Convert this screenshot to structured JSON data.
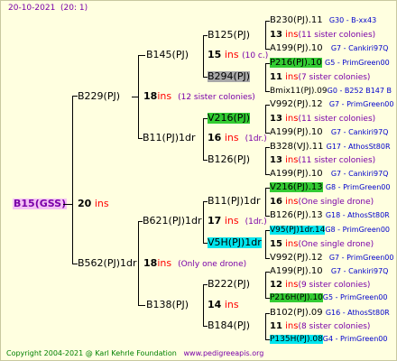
{
  "header": {
    "date": "20-10-2021",
    "time": "(20:  1)"
  },
  "footer": {
    "copyright": "Copyright 2004-2021 @ Karl Kehrle Foundation",
    "site": "www.pedigreeapis.org"
  },
  "root": {
    "name": "B15(GSS)",
    "ins_num": "20",
    "ins": "ins"
  },
  "gen1": {
    "top": {
      "name": "B229(PJ)",
      "ins_num": "18",
      "ins": "ins",
      "sisters": "(12 sister colonies)"
    },
    "bottom": {
      "name": "B562(PJ)1dr",
      "ins_num": "18",
      "ins": "ins",
      "note": "(Only one drone)"
    }
  },
  "gen2": {
    "b145": {
      "name": "B145(PJ)",
      "ins_num": "15",
      "ins": "ins",
      "note": "(10 c.)"
    },
    "b11": {
      "name": "B11(PJ)1dr",
      "ins_num": "16",
      "ins": "ins",
      "note": "(1dr.)"
    },
    "b621": {
      "name": "B621(PJ)1dr",
      "ins_num": "17",
      "ins": "ins",
      "note": "(1dr.)"
    },
    "b138": {
      "name": "B138(PJ)",
      "ins_num": "14",
      "ins": "ins"
    }
  },
  "gen3": {
    "b125a": {
      "name": "B125(PJ)"
    },
    "b294": {
      "name": "B294(PJ)"
    },
    "v216": {
      "name": "V216(PJ)"
    },
    "b126": {
      "name": "B126(PJ)"
    },
    "b11b": {
      "name": "B11(PJ)1dr"
    },
    "v5h": {
      "name": "V5H(PJ)1dr"
    },
    "b222": {
      "name": "B222(PJ)"
    },
    "b184": {
      "name": "B184(PJ)"
    }
  },
  "gen4": {
    "r1": {
      "name": "B230(PJ).11",
      "code": "G30 - B-xx43"
    },
    "r2": {
      "num": "13",
      "ins": "ins",
      "note": "(11 sister colonies)"
    },
    "r3": {
      "name": "A199(PJ).10",
      "code": "G7 - Cankiri97Q"
    },
    "r4": {
      "name": "P216(PJ).10",
      "code": "G5 - PrimGreen00"
    },
    "r5": {
      "num": "11",
      "ins": "ins",
      "note": "(7 sister colonies)"
    },
    "r6": {
      "name": "Bmix11(PJ).09",
      "code": "G0 - B252 B147 B"
    },
    "r7": {
      "name": "V992(PJ).12",
      "code": "G7 - PrimGreen00"
    },
    "r8": {
      "num": "13",
      "ins": "ins",
      "note": "(11 sister colonies)"
    },
    "r9": {
      "name": "A199(PJ).10",
      "code": "G7 - Cankiri97Q"
    },
    "r10": {
      "name": "B328(VJ).11",
      "code": "G17 - AthosSt80R"
    },
    "r11": {
      "num": "13",
      "ins": "ins",
      "note": "(11 sister colonies)"
    },
    "r12": {
      "name": "A199(PJ).10",
      "code": "G7 - Cankiri97Q"
    },
    "r13": {
      "name": "V216(PJ).13",
      "code": "G8 - PrimGreen00"
    },
    "r14": {
      "num": "16",
      "ins": "ins",
      "note": "(One single drone)"
    },
    "r15": {
      "name": "B126(PJ).13",
      "code": "G18 - AthosSt80R"
    },
    "r16": {
      "name": "V95(PJ)1dr.14",
      "code": "G8 - PrimGreen00"
    },
    "r17": {
      "num": "15",
      "ins": "ins",
      "note": "(One single drone)"
    },
    "r18": {
      "name": "V992(PJ).12",
      "code": "G7 - PrimGreen00"
    },
    "r19": {
      "name": "A199(PJ).10",
      "code": "G7 - Cankiri97Q"
    },
    "r20": {
      "num": "12",
      "ins": "ins",
      "note": "(9 sister colonies)"
    },
    "r21": {
      "name": "P216H(PJ).10",
      "code": "G5 - PrimGreen00"
    },
    "r22": {
      "name": "B102(PJ).09",
      "code": "G16 - AthosSt80R"
    },
    "r23": {
      "num": "11",
      "ins": "ins",
      "note": "(8 sister colonies)"
    },
    "r24": {
      "name": "P135H(PJ).08",
      "code": "G4 - PrimGreen00"
    }
  }
}
